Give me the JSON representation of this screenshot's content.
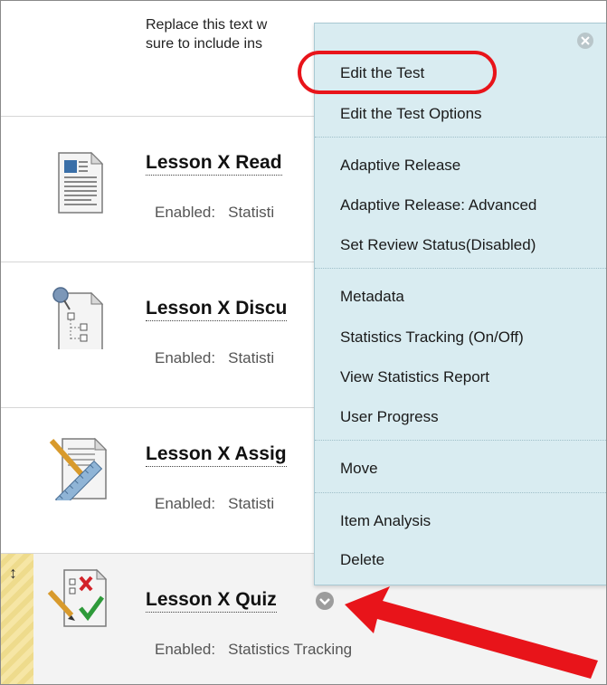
{
  "content": {
    "description_text": "Replace this text w\nsure to include ins",
    "items": [
      {
        "title": "Lesson X Read",
        "status_label": "Enabled:",
        "status_value": "Statisti",
        "icon": "document-icon"
      },
      {
        "title": "Lesson X Discu",
        "status_label": "Enabled:",
        "status_value": "Statisti",
        "icon": "discussion-icon"
      },
      {
        "title": "Lesson X Assig",
        "status_label": "Enabled:",
        "status_value": "Statisti",
        "icon": "assignment-icon"
      },
      {
        "title": "Lesson X Quiz",
        "status_label": "Enabled:",
        "status_value": "Statistics Tracking",
        "icon": "quiz-icon"
      }
    ]
  },
  "context_menu": {
    "items": [
      "Edit the Test",
      "Edit the Test Options",
      "Adaptive Release",
      "Adaptive Release: Advanced",
      "Set Review Status(Disabled)",
      "Metadata",
      "Statistics Tracking (On/Off)",
      "View Statistics Report",
      "User Progress",
      "Move",
      "Item Analysis",
      "Delete"
    ]
  },
  "colors": {
    "menu_bg": "#d9ecf1",
    "annotation_red": "#e8141a",
    "drag_strip": "#f6e6a5"
  }
}
